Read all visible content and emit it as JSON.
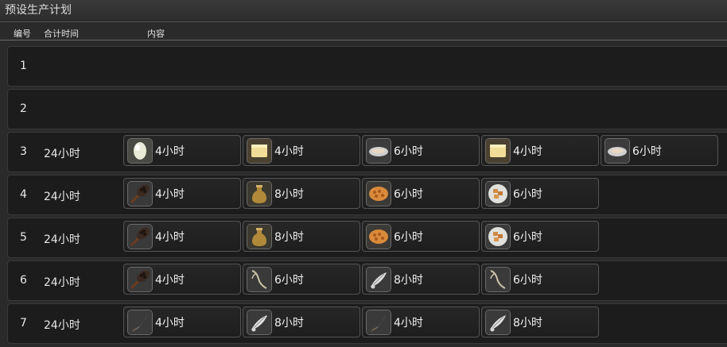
{
  "window": {
    "title": "预设生产计划"
  },
  "header": {
    "col_number": "编号",
    "col_total": "合计时间",
    "col_content": "内容"
  },
  "rows": [
    {
      "num": "1",
      "total": "",
      "items": []
    },
    {
      "num": "2",
      "total": "",
      "items": []
    },
    {
      "num": "3",
      "total": "24小时",
      "items": [
        {
          "icon": "egg-icon",
          "duration": "4小时"
        },
        {
          "icon": "cheese-icon",
          "duration": "4小时"
        },
        {
          "icon": "dish-icon",
          "duration": "6小时"
        },
        {
          "icon": "cheese-icon",
          "duration": "4小时"
        },
        {
          "icon": "dish-icon",
          "duration": "6小时"
        }
      ]
    },
    {
      "num": "4",
      "total": "24小时",
      "items": [
        {
          "icon": "beans-icon",
          "duration": "4小时"
        },
        {
          "icon": "oil-jar-icon",
          "duration": "8小时"
        },
        {
          "icon": "waffle-icon",
          "duration": "6小时"
        },
        {
          "icon": "pastry-plate-icon",
          "duration": "6小时"
        }
      ]
    },
    {
      "num": "5",
      "total": "24小时",
      "items": [
        {
          "icon": "beans-icon",
          "duration": "4小时"
        },
        {
          "icon": "oil-jar-icon",
          "duration": "8小时"
        },
        {
          "icon": "waffle-icon",
          "duration": "6小时"
        },
        {
          "icon": "pastry-plate-icon",
          "duration": "6小时"
        }
      ]
    },
    {
      "num": "6",
      "total": "24小时",
      "items": [
        {
          "icon": "beans-icon",
          "duration": "4小时"
        },
        {
          "icon": "branch-icon",
          "duration": "6小时"
        },
        {
          "icon": "feather-icon",
          "duration": "8小时"
        },
        {
          "icon": "branch-icon",
          "duration": "6小时"
        }
      ]
    },
    {
      "num": "7",
      "total": "24小时",
      "items": [
        {
          "icon": "fang-icon",
          "duration": "4小时"
        },
        {
          "icon": "feather-icon",
          "duration": "8小时"
        },
        {
          "icon": "fang-icon",
          "duration": "4小时"
        },
        {
          "icon": "feather-icon",
          "duration": "8小时"
        }
      ]
    }
  ]
}
